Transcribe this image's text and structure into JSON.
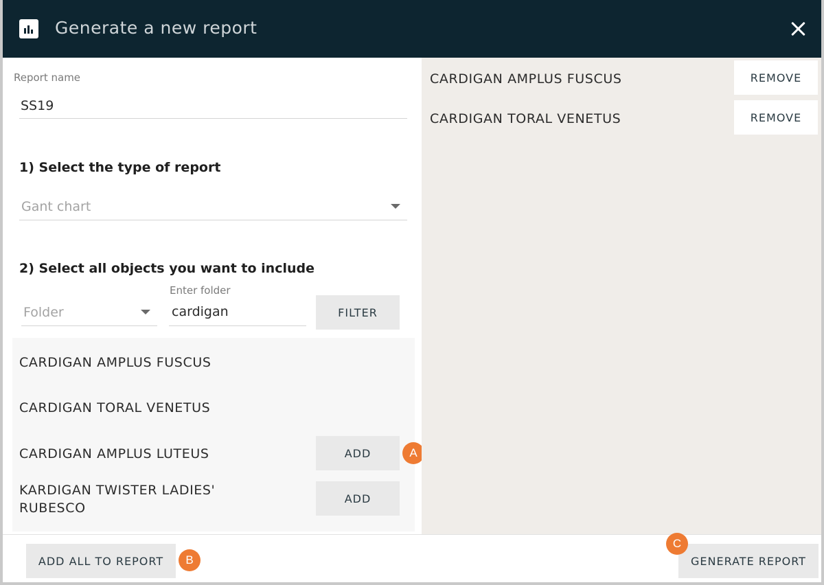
{
  "header": {
    "title": "Generate a new report",
    "icon": "bar-chart-icon",
    "close_icon": "close-icon"
  },
  "form": {
    "report_name_label": "Report name",
    "report_name_value": "SS19",
    "step1_title": "1) Select the type of report",
    "report_type_value": "Gant chart",
    "step2_title": "2) Select all objects you want to include",
    "folder_select_value": "Folder",
    "folder_input_label": "Enter folder",
    "folder_input_value": "cardigan",
    "filter_label": "FILTER"
  },
  "available_items": [
    {
      "name": "CARDIGAN AMPLUS FUSCUS",
      "action": ""
    },
    {
      "name": "CARDIGAN TORAL VENETUS",
      "action": ""
    },
    {
      "name": "CARDIGAN AMPLUS LUTEUS",
      "action": "ADD"
    },
    {
      "name": "KARDIGAN TWISTER LADIES' RUBESCO",
      "action": "ADD"
    }
  ],
  "selected_items": [
    {
      "name": "CARDIGAN AMPLUS FUSCUS",
      "action": "REMOVE"
    },
    {
      "name": "CARDIGAN TORAL VENETUS",
      "action": "REMOVE"
    }
  ],
  "footer": {
    "add_all_label": "ADD ALL TO REPORT",
    "generate_label": "GENERATE REPORT"
  },
  "annotations": {
    "a": "A",
    "b": "B",
    "c": "C"
  },
  "colors": {
    "header_bg": "#0d2530",
    "selected_panel_bg": "#f0ede9",
    "badge": "#ee7b33"
  }
}
